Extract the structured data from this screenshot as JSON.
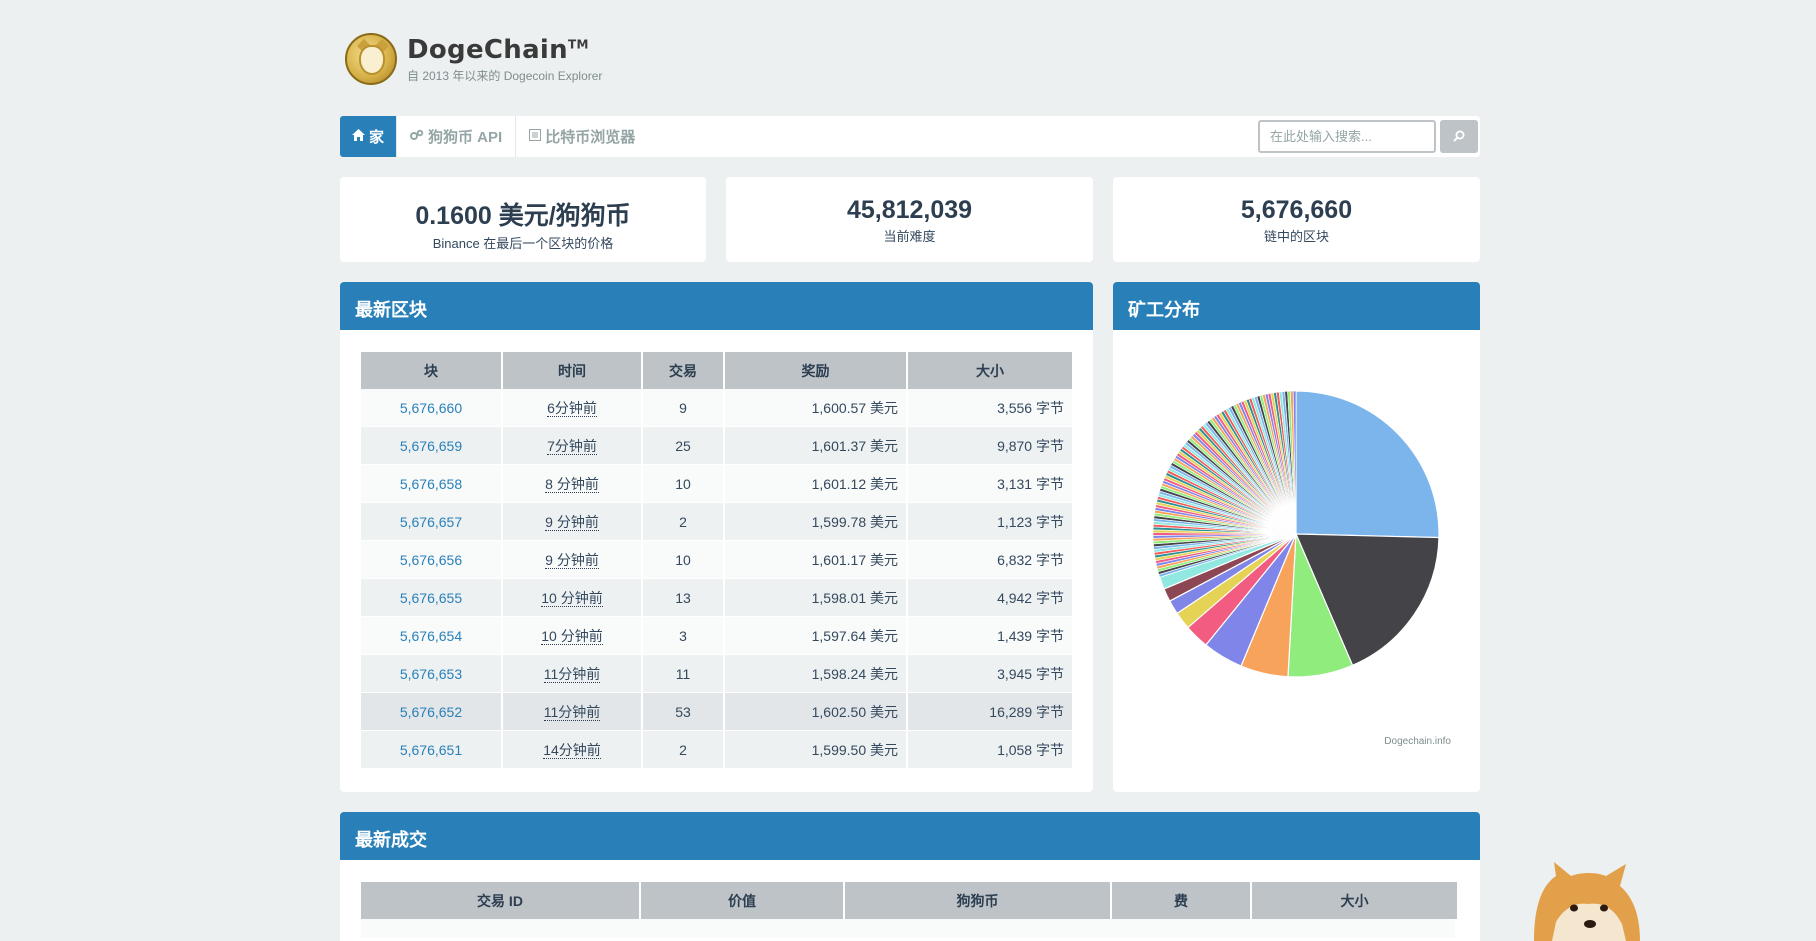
{
  "brand": {
    "title": "DogeChain",
    "tm": "TM",
    "subtitle": "自 2013 年以来的 Dogecoin Explorer"
  },
  "nav": {
    "items": [
      {
        "label": "家",
        "icon": "home-icon",
        "active": true
      },
      {
        "label": "狗狗币 API",
        "icon": "gears-icon"
      },
      {
        "label": "比特币浏览器",
        "icon": "list-icon"
      }
    ],
    "search_placeholder": "在此处输入搜索..."
  },
  "stats": [
    {
      "value": "0.1600 美元/狗狗币",
      "label": "Binance 在最后一个区块的价格"
    },
    {
      "value": "45,812,039",
      "label": "当前难度"
    },
    {
      "value": "5,676,660",
      "label": "链中的区块"
    }
  ],
  "latest_blocks": {
    "title": "最新区块",
    "headers": [
      "块",
      "时间",
      "交易",
      "奖励",
      "大小"
    ],
    "rows": [
      [
        "5,676,660",
        "6分钟前",
        "9",
        "1,600.57 美元",
        "3,556 字节"
      ],
      [
        "5,676,659",
        "7分钟前",
        "25",
        "1,601.37 美元",
        "9,870 字节"
      ],
      [
        "5,676,658",
        "8 分钟前",
        "10",
        "1,601.12 美元",
        "3,131 字节"
      ],
      [
        "5,676,657",
        "9 分钟前",
        "2",
        "1,599.78 美元",
        "1,123 字节"
      ],
      [
        "5,676,656",
        "9 分钟前",
        "10",
        "1,601.17 美元",
        "6,832 字节"
      ],
      [
        "5,676,655",
        "10 分钟前",
        "13",
        "1,598.01 美元",
        "4,942 字节"
      ],
      [
        "5,676,654",
        "10 分钟前",
        "3",
        "1,597.64 美元",
        "1,439 字节"
      ],
      [
        "5,676,653",
        "11分钟前",
        "11",
        "1,598.24 美元",
        "3,945 字节"
      ],
      [
        "5,676,652",
        "11分钟前",
        "53",
        "1,602.50 美元",
        "16,289 字节"
      ],
      [
        "5,676,651",
        "14分钟前",
        "2",
        "1,599.50 美元",
        "1,058 字节"
      ]
    ]
  },
  "miner_distribution": {
    "title": "矿工分布",
    "credit": "Dogechain.info",
    "slices": [
      {
        "value": 25.5,
        "color": "#7cb5ec"
      },
      {
        "value": 18.2,
        "color": "#434348"
      },
      {
        "value": 7.4,
        "color": "#90ed7d"
      },
      {
        "value": 5.4,
        "color": "#f7a35c"
      },
      {
        "value": 4.6,
        "color": "#8085e9"
      },
      {
        "value": 2.8,
        "color": "#f15c80"
      },
      {
        "value": 2.0,
        "color": "#e4d354"
      },
      {
        "value": 1.6,
        "color": "#8085e8"
      },
      {
        "value": 1.5,
        "color": "#8d4653"
      },
      {
        "value": 1.4,
        "color": "#91e8e1"
      }
    ],
    "tail_count": 95,
    "tail_value": 30.0,
    "tail_colors": [
      "#7cb5ec",
      "#434348",
      "#90ed7d",
      "#f7a35c",
      "#8085e9",
      "#f15c80",
      "#e4d354",
      "#2b908f",
      "#f45b5b",
      "#91e8e1"
    ]
  },
  "latest_transactions": {
    "title": "最新成交",
    "headers": [
      "交易 ID",
      "价值",
      "狗狗币",
      "费",
      "大小"
    ]
  }
}
